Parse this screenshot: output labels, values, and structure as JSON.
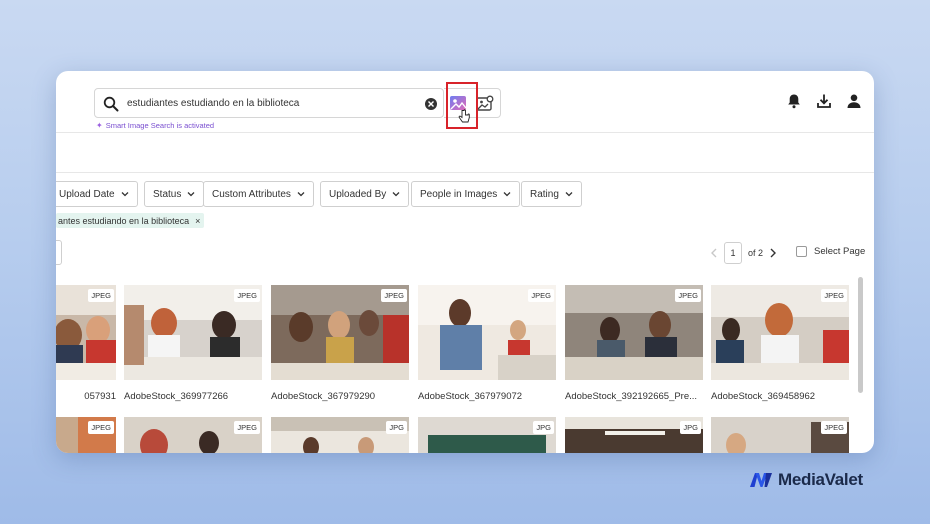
{
  "search": {
    "query": "estudiantes estudiando en la biblioteca",
    "smart_note": "Smart Image Search is activated"
  },
  "filters": [
    {
      "label": "Upload Date"
    },
    {
      "label": "Status"
    },
    {
      "label": "Custom Attributes"
    },
    {
      "label": "Uploaded By"
    },
    {
      "label": "People in Images"
    },
    {
      "label": "Rating"
    }
  ],
  "active_chip": {
    "label": "antes estudiando en la biblioteca"
  },
  "pager": {
    "current": "1",
    "of_total": "of 2"
  },
  "select_page": {
    "label": "Select Page"
  },
  "assets": [
    {
      "name": "057931",
      "type": "JPEG"
    },
    {
      "name": "AdobeStock_369977266",
      "type": "JPEG"
    },
    {
      "name": "AdobeStock_367979290",
      "type": "JPEG"
    },
    {
      "name": "AdobeStock_367979072",
      "type": "JPEG"
    },
    {
      "name": "AdobeStock_392192665_Pre...",
      "type": "JPEG"
    },
    {
      "name": "AdobeStock_369458962",
      "type": "JPEG"
    }
  ],
  "assets_row2": [
    {
      "type": "JPEG"
    },
    {
      "type": "JPEG"
    },
    {
      "type": "JPG"
    },
    {
      "type": "JPG"
    },
    {
      "type": "JPG"
    },
    {
      "type": "JPEG"
    }
  ],
  "brand": {
    "name": "MediaValet",
    "color": "#1f3fd1"
  },
  "colors": {
    "highlight": "#d8232a",
    "smart": "#7a4fd0",
    "chip": "#e4f4ef"
  }
}
